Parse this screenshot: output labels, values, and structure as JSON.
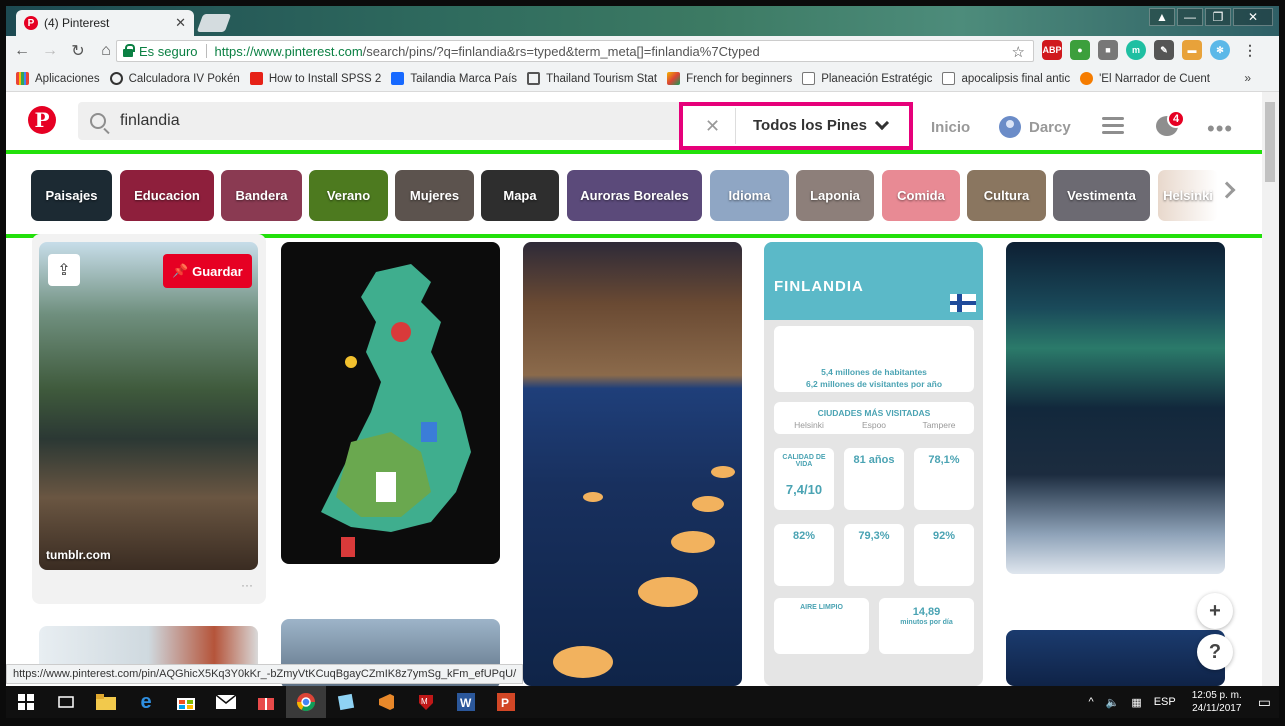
{
  "browser": {
    "tab_title": "(4) Pinterest",
    "secure_label": "Es seguro",
    "url_host": "https://www.pinterest.com",
    "url_path": "/search/pins/?q=finlandia&rs=typed&term_meta[]=finlandia%7Ctyped",
    "bookmarks": [
      {
        "label": "Aplicaciones",
        "color": "#5f6368"
      },
      {
        "label": "Calculadora IV Pokén",
        "color": "#333333"
      },
      {
        "label": "How to Install SPSS 2",
        "color": "#e62117"
      },
      {
        "label": "Tailandia Marca País",
        "color": "#1769ff"
      },
      {
        "label": "Thailand Tourism Stat",
        "color": "#333333"
      },
      {
        "label": "French for beginners",
        "color": "#f4b400"
      },
      {
        "label": "Planeación Estratégic",
        "color": "#666666"
      },
      {
        "label": "apocalipsis final antic",
        "color": "#666666"
      },
      {
        "label": "'El Narrador de Cuent",
        "color": "#f57c00"
      }
    ],
    "bookmarks_more": "»",
    "status_url": "https://www.pinterest.com/pin/AQGhicX5Kq3Y0kKr_-bZmyVtKCuqBgayCZmIK8z7ymSg_kFm_efUPqU/"
  },
  "pinterest": {
    "search_value": "finlandia",
    "filter_label": "Todos los Pines",
    "nav_home": "Inicio",
    "user_name": "Darcy",
    "notification_count": "4",
    "save_button": "Guardar",
    "pin_source": "tumblr.com",
    "pin_more": "···",
    "fab_add": "+",
    "fab_help": "?",
    "guides": [
      {
        "label": "Paisajes",
        "color": "#1c2a33"
      },
      {
        "label": "Educacion",
        "color": "#8e1f3c"
      },
      {
        "label": "Bandera",
        "color": "#8a3a52"
      },
      {
        "label": "Verano",
        "color": "#4d7a1f"
      },
      {
        "label": "Mujeres",
        "color": "#5c534e"
      },
      {
        "label": "Mapa",
        "color": "#2e2e2e"
      },
      {
        "label": "Auroras Boreales",
        "color": "#5b4a7a"
      },
      {
        "label": "Idioma",
        "color": "#8fa6c4"
      },
      {
        "label": "Laponia",
        "color": "#8d7f7a"
      },
      {
        "label": "Comida",
        "color": "#e88a94"
      },
      {
        "label": "Cultura",
        "color": "#8a7660"
      },
      {
        "label": "Vestimenta",
        "color": "#6c6a72"
      },
      {
        "label": "Helsinki",
        "color": "#e8d8cc"
      }
    ],
    "infographic": {
      "title": "FINLANDIA",
      "population_line1": "5,4 millones de habitantes",
      "population_line2": "6,2 millones de visitantes por año",
      "cities_heading": "CIUDADES MÁS VISITADAS",
      "cities": [
        "Helsinki",
        "Espoo",
        "Tampere"
      ],
      "quality_label": "CALIDAD DE VIDA",
      "quality_value": "7,4/10",
      "years_value": "81 años",
      "percent_value": "78,1%",
      "stat_82": "82%",
      "stat_793": "79,3%",
      "stat_92": "92%",
      "air_label": "AIRE LIMPIO",
      "minutes_value": "14,89",
      "minutes_label": "minutos por día"
    }
  },
  "taskbar": {
    "lang": "ESP",
    "time": "12:05 p. m.",
    "date": "24/11/2017"
  }
}
